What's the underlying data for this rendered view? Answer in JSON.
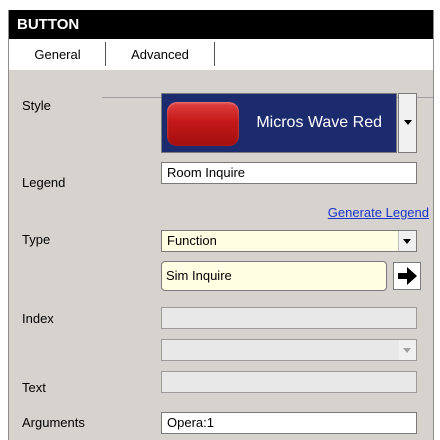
{
  "header": {
    "title": "BUTTON"
  },
  "tabs": {
    "general": "General",
    "advanced": "Advanced"
  },
  "labels": {
    "style": "Style",
    "legend": "Legend",
    "type": "Type",
    "index": "Index",
    "text": "Text",
    "arguments": "Arguments"
  },
  "style": {
    "name": "Micros Wave Red",
    "swatch_color": "#c41818",
    "background_color": "#1c2a6e"
  },
  "legend": {
    "value": "Room Inquire"
  },
  "generate_legend": {
    "label": "Generate Legend"
  },
  "type": {
    "value": "Function"
  },
  "function": {
    "value": "Sim Inquire"
  },
  "arguments": {
    "value": "Opera:1"
  }
}
